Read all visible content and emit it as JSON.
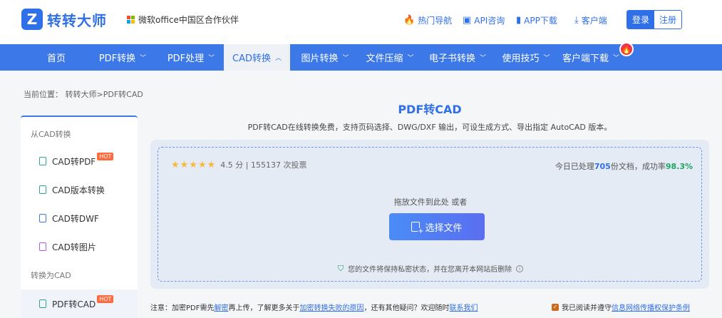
{
  "header": {
    "logo_text": "转转大师",
    "logo_mark": "Z",
    "partner_text": "微软office中国区合作伙伴",
    "links": [
      "热门导航",
      "API咨询",
      "APP下载",
      "客户端"
    ],
    "login_label": "登录",
    "register_label": "注册"
  },
  "nav": {
    "items": [
      "首页",
      "PDF转换",
      "PDF处理",
      "CAD转换",
      "图片转换",
      "文件压缩",
      "电子书转换",
      "使用技巧",
      "客户端下载"
    ],
    "hot_badge": "🔥"
  },
  "breadcrumb": {
    "label": "当前位置：",
    "home": "转转大师",
    "sep": ">",
    "current": "PDF转CAD"
  },
  "sidebar": {
    "group1": "从CAD转换",
    "group2": "转换为CAD",
    "items": [
      "CAD转PDF",
      "CAD版本转换",
      "CAD转DWF",
      "CAD转图片",
      "PDF转CAD"
    ],
    "hot_label": "HOT"
  },
  "main": {
    "title": "PDF转CAD",
    "desc": "PDF转CAD在线转换免费，支持页码选择、DWG/DXF 输出，可设生成方式、导出指定 AutoCAD 版本。",
    "stars": "★★★★★",
    "rating": "4.5 分 | 155137 次投票",
    "stats_prefix": "今日已处理",
    "stats_count": "705",
    "stats_mid": "份文档，成功率",
    "stats_rate": "98.3%",
    "drop_hint": "拖放文件到此处 或者",
    "select_label": "选择文件",
    "privacy": "您的文件将保持私密状态，并在您离开本网站后删除",
    "privacy_info": "i"
  },
  "notice": {
    "prefix": "注意：加密PDF需先",
    "link1": "解密",
    "mid1": "再上传，了解更多关于",
    "link2": "加密转换失败的原因",
    "mid2": "，还有其他疑问？欢迎随时",
    "link3": "联系我们"
  },
  "agree": {
    "prefix": "我已阅读并遵守",
    "link": "信息网络传播权保护条例"
  },
  "colors": {
    "brand": "#2f6fe8",
    "nav_bg": "#3d78e9",
    "success": "#1fa463",
    "hot": "#ff6a3d"
  }
}
